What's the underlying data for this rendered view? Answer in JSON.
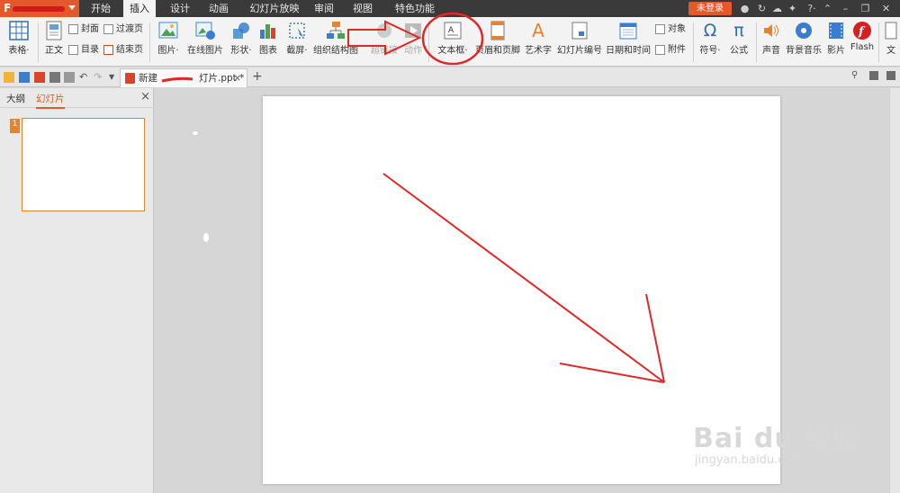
{
  "app": {
    "logo_letter": "F",
    "menu_tabs": [
      "开始",
      "插入",
      "设计",
      "动画",
      "幻灯片放映",
      "审阅",
      "视图",
      "特色功能"
    ],
    "active_tab": "插入",
    "login_label": "未登录",
    "accent": "#e4592b"
  },
  "ribbon": {
    "table": "表格·",
    "main_text": "正文",
    "cover": "封面",
    "toc": "目录",
    "transition_page": "过渡页",
    "end_page": "结束页",
    "picture": "图片·",
    "online_picture": "在线图片",
    "shape": "形状·",
    "chart": "图表",
    "screenshot": "截屏·",
    "org_chart": "组织结构图",
    "hyperlink": "超链接",
    "action": "动作",
    "textbox": "文本框·",
    "header_footer": "页眉和页脚",
    "wordart": "艺术字",
    "slide_number": "幻灯片编号",
    "date_time": "日期和时间",
    "object": "对象",
    "attachment": "附件",
    "symbol": "符号·",
    "formula": "公式",
    "sound": "声音",
    "bg_music": "背景音乐",
    "movie": "影片",
    "flash": "Flash",
    "more": "文"
  },
  "icons": {
    "omega": "Ω",
    "pi": "π",
    "wordart_a": "A",
    "flash_f": "f"
  },
  "document": {
    "tab_name_prefix": "新建",
    "tab_name_suffix": "灯片.ppt *",
    "close": "×",
    "add": "+"
  },
  "left_panel": {
    "tabs": [
      "大纲",
      "幻灯片"
    ],
    "active_tab": "幻灯片",
    "close": "×",
    "slide_number": "1"
  },
  "watermark": {
    "logo": "Bai du 经验",
    "url": "jingyan.baidu.com"
  },
  "annotations": {
    "color": "#e02828"
  }
}
